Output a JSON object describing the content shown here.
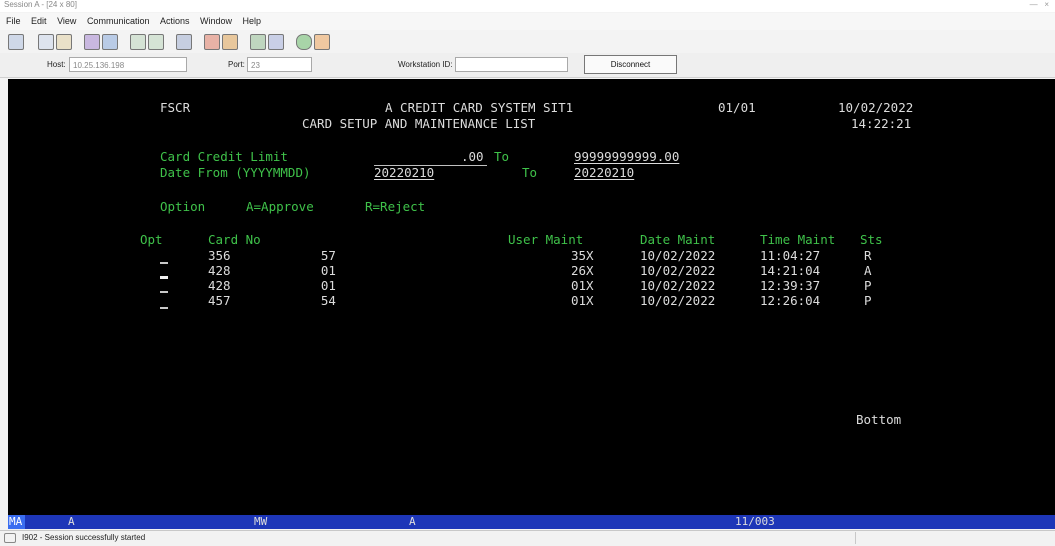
{
  "window": {
    "title": "Session A - [24 x 80]"
  },
  "menu": [
    "File",
    "Edit",
    "View",
    "Communication",
    "Actions",
    "Window",
    "Help"
  ],
  "toolbar_icons": [
    "print-screen-icon",
    "copy-icon",
    "paste-icon",
    "send-icon",
    "receive-icon",
    "display-icon",
    "keyboard-icon",
    "macro-icon",
    "record-icon",
    "play-icon",
    "chart-icon",
    "stop-icon",
    "globe-icon",
    "edit-icon"
  ],
  "connection": {
    "host_label": "Host:",
    "host_value": "10.25.136.198",
    "port_label": "Port:",
    "port_value": "23",
    "ws_label": "Workstation ID:",
    "ws_value": "",
    "disconnect": "Disconnect"
  },
  "screen": {
    "program": "FSCR",
    "title1": "A CREDIT CARD SYSTEM SIT1",
    "title2": "CARD SETUP AND MAINTENANCE LIST",
    "page": "01/01",
    "date": "10/02/2022",
    "time": "14:22:21",
    "credit_label": "Card Credit Limit",
    "credit_from": ".00",
    "to1": "To",
    "credit_to": "99999999999.00",
    "date_label": "Date From (YYYYMMDD)",
    "date_from": "20220210",
    "to2": "To",
    "date_to": "20220210",
    "option_label": "Option",
    "option_approve": "A=Approve",
    "option_reject": "R=Reject",
    "headers": {
      "opt": "Opt",
      "card_no": "Card No",
      "user": "User Maint",
      "date": "Date Maint",
      "time": "Time Maint",
      "sts": "Sts"
    },
    "rows": [
      {
        "card": "356            57",
        "user": "35X",
        "date": "10/02/2022",
        "time": "11:04:27",
        "sts": "R"
      },
      {
        "card": "428            01",
        "user": "26X",
        "date": "10/02/2022",
        "time": "14:21:04",
        "sts": "A"
      },
      {
        "card": "428            01",
        "user": "01X",
        "date": "10/02/2022",
        "time": "12:39:37",
        "sts": "P"
      },
      {
        "card": "457            54",
        "user": "01X",
        "date": "10/02/2022",
        "time": "12:26:04",
        "sts": "P"
      }
    ],
    "bottom": "Bottom"
  },
  "oia": {
    "ma": "MA",
    "a1": "A",
    "mw": "MW",
    "a2": "A",
    "cursor": "11/003"
  },
  "status": {
    "message": "I902 - Session successfully started"
  }
}
